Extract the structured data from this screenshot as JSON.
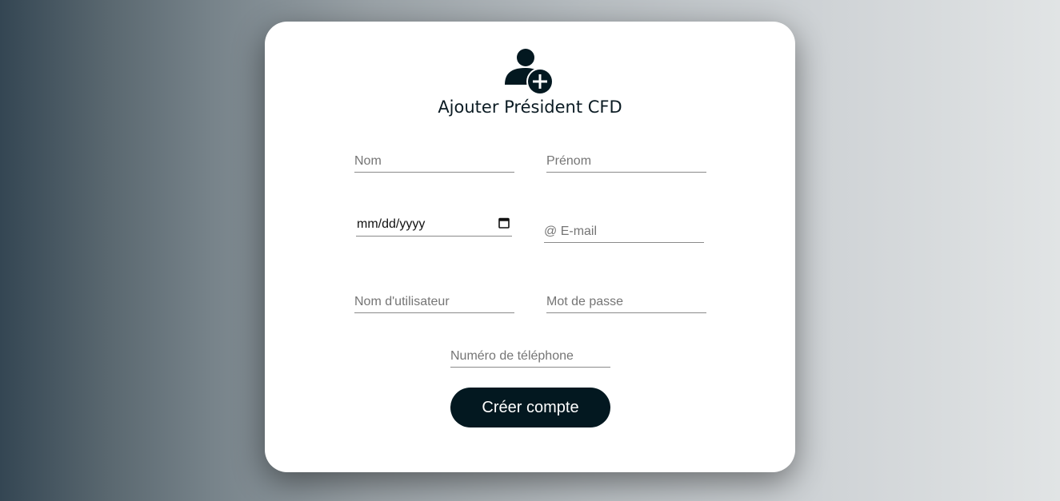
{
  "form": {
    "title": "Ajouter Président CFD",
    "icon": "add-user-icon",
    "fields": {
      "nom": {
        "placeholder": "Nom"
      },
      "prenom": {
        "placeholder": "Prénom"
      },
      "date": {
        "placeholder": "mm/dd/yyyy",
        "icon": "calendar-icon"
      },
      "email": {
        "placeholder": "@ E-mail"
      },
      "username": {
        "placeholder": "Nom d'utilisateur"
      },
      "password": {
        "placeholder": "Mot de passe"
      },
      "phone": {
        "placeholder": "Numéro de téléphone"
      }
    },
    "submit_label": "Créer compte"
  },
  "colors": {
    "accent": "#031820",
    "card": "#ffffff",
    "gradient_left": "#344653",
    "gradient_right": "#e1e4e5"
  }
}
